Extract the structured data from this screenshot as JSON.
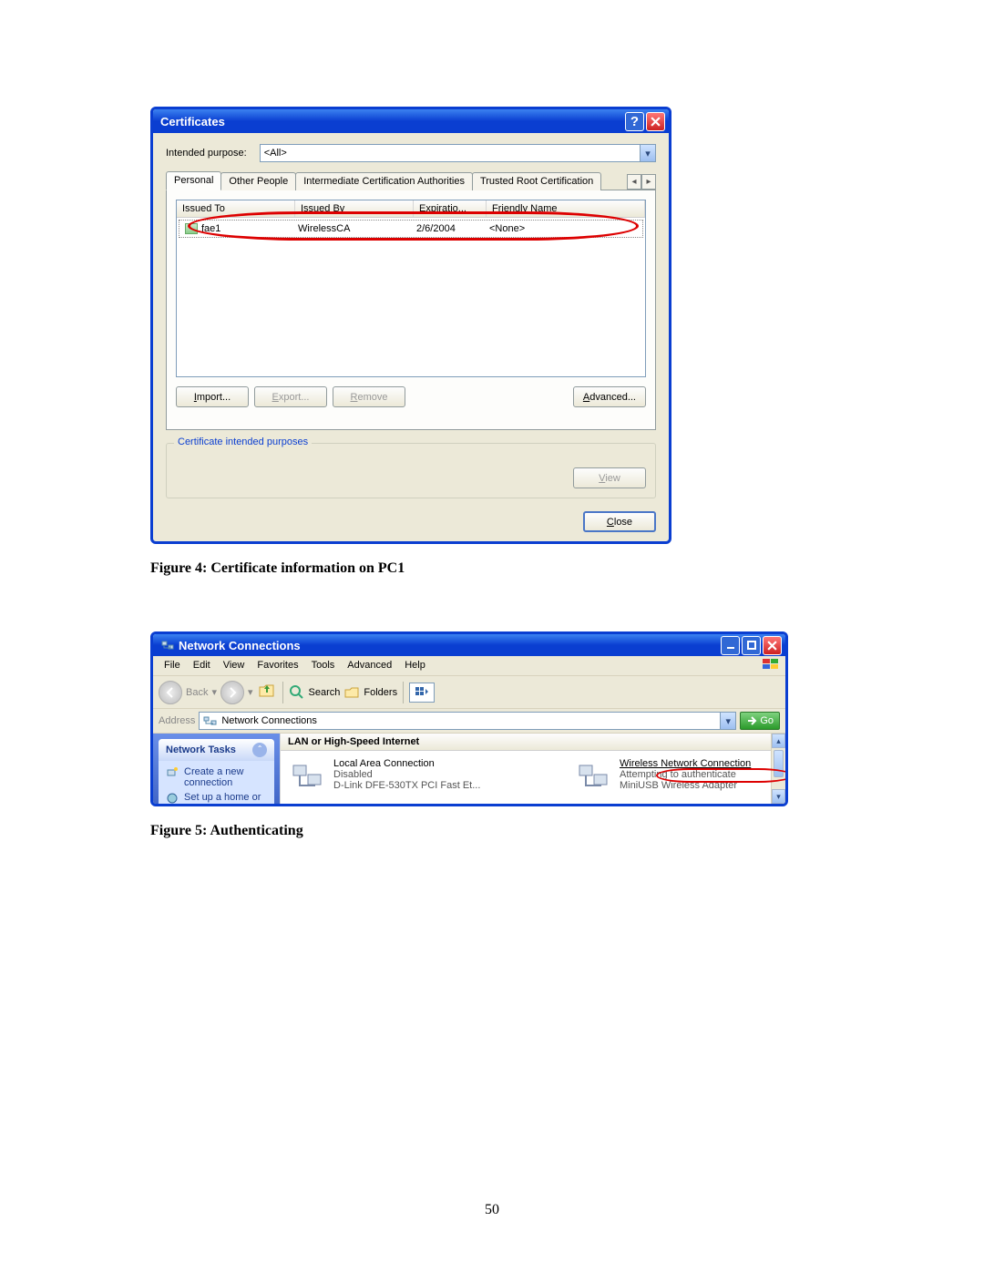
{
  "caption1": "Figure 4: Certificate information on PC1",
  "caption2": "Figure 5: Authenticating",
  "page_num": "50",
  "certs": {
    "title": "Certificates",
    "purpose_label": "Intended purpose:",
    "purpose_value": "<All>",
    "tabs": [
      "Personal",
      "Other People",
      "Intermediate Certification Authorities",
      "Trusted Root Certification"
    ],
    "columns": [
      "Issued To",
      "Issued By",
      "Expiratio...",
      "Friendly Name"
    ],
    "rows": [
      {
        "issued_to": "fae1",
        "issued_by": "WirelessCA",
        "expires": "2/6/2004",
        "friendly": "<None>"
      }
    ],
    "buttons": {
      "import": "Import...",
      "export": "Export...",
      "remove": "Remove",
      "advanced": "Advanced...",
      "view": "View",
      "close": "Close"
    },
    "group_label": "Certificate intended purposes"
  },
  "net": {
    "title": "Network Connections",
    "menu": [
      "File",
      "Edit",
      "View",
      "Favorites",
      "Tools",
      "Advanced",
      "Help"
    ],
    "toolbar": {
      "back": "Back",
      "search": "Search",
      "folders": "Folders"
    },
    "address_label": "Address",
    "address_value": "Network Connections",
    "go": "Go",
    "tasks_title": "Network Tasks",
    "tasks": [
      "Create a new connection",
      "Set up a home or small office network"
    ],
    "category": "LAN or High-Speed Internet",
    "conn1": {
      "name": "Local Area Connection",
      "status": "Disabled",
      "device": "D-Link DFE-530TX PCI Fast Et..."
    },
    "conn2": {
      "name": "Wireless Network Connection",
      "status": "Attempting to authenticate",
      "device": "MiniUSB Wireless Adapter"
    }
  }
}
